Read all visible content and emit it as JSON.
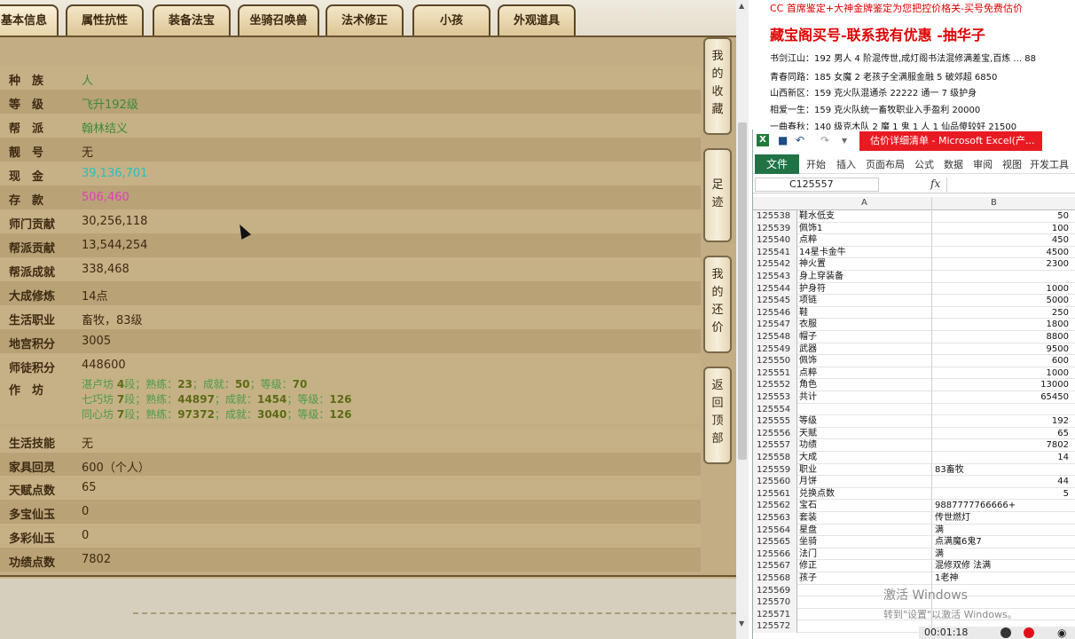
{
  "tabs": [
    "基本信息",
    "属性抗性",
    "装备法宝",
    "坐骑召唤兽",
    "法术修正",
    "小孩",
    "外观道具"
  ],
  "rows": [
    {
      "label": "种　族",
      "value": "人",
      "color": "green"
    },
    {
      "label": "等　级",
      "value": "飞升192级",
      "color": "green"
    },
    {
      "label": "帮　派",
      "value": "翰林结义",
      "color": "green"
    },
    {
      "label": "靓　号",
      "value": "无",
      "color": "normal"
    },
    {
      "label": "现　金",
      "value": "39,136,701",
      "color": "cyan"
    },
    {
      "label": "存　款",
      "value": "506,460",
      "color": "pink"
    },
    {
      "label": "师门贡献",
      "value": "30,256,118",
      "color": "normal"
    },
    {
      "label": "帮派贡献",
      "value": "13,544,254",
      "color": "normal"
    },
    {
      "label": "帮派成就",
      "value": "338,468",
      "color": "normal"
    },
    {
      "label": "大成修炼",
      "value": "14点",
      "color": "normal"
    },
    {
      "label": "生活职业",
      "value": "畜牧，83级",
      "color": "normal"
    },
    {
      "label": "地宫积分",
      "value": "3005",
      "color": "normal"
    },
    {
      "label": "师徒积分",
      "value": "448600",
      "color": "normal"
    }
  ],
  "workshop": {
    "label": "作　坊",
    "lines": [
      {
        "name": "湛卢坊",
        "seg": "4",
        "seg_unit": "段；熟练：",
        "skill": "23",
        "ach_label": "；成就：",
        "ach": "50",
        "lvl_label": "；等级：",
        "lvl": "70"
      },
      {
        "name": "七巧坊",
        "seg": "7",
        "seg_unit": "段；熟练：",
        "skill": "44897",
        "ach_label": "；成就：",
        "ach": "1454",
        "lvl_label": "；等级：",
        "lvl": "126"
      },
      {
        "name": "同心坊",
        "seg": "7",
        "seg_unit": "段；熟练：",
        "skill": "97372",
        "ach_label": "；成就：",
        "ach": "3040",
        "lvl_label": "；等级：",
        "lvl": "126"
      }
    ]
  },
  "rows2": [
    {
      "label": "生活技能",
      "value": "无",
      "color": "normal"
    },
    {
      "label": "家具回灵",
      "value": "600（个人）",
      "color": "normal"
    },
    {
      "label": "天赋点数",
      "value": "65",
      "color": "normal"
    },
    {
      "label": "多宝仙玉",
      "value": "0",
      "color": "normal"
    },
    {
      "label": "多彩仙玉",
      "value": "0",
      "color": "normal"
    },
    {
      "label": "功绩点数",
      "value": "7802",
      "color": "normal"
    }
  ],
  "side_buttons": [
    {
      "chars": [
        "我",
        "的",
        "收",
        "藏"
      ]
    },
    {
      "chars": [
        "足",
        "迹"
      ]
    },
    {
      "chars": [
        "我",
        "的",
        "还",
        "价"
      ]
    },
    {
      "chars": [
        "返",
        "回",
        "顶",
        "部"
      ]
    }
  ],
  "doc": {
    "top": "CC 首席鉴定+大神金牌鉴定为您把控价格关-买号免费估价",
    "head": "藏宝阁买号-联系我有优惠 -抽华子",
    "lines": [
      "书剑江山：192 男人 4 阶混传世,成灯阁书法混修满差宝,百炼 ... 88",
      "青春同路：185 女魔 2 老孩子全满服金融 5 破郊超 6850",
      "山西新区：159 克火队混通杀 22222 通一 7 级护身",
      "相爱一生：159 克火队统一畜牧职业入手盈利 20000",
      "一曲春秋：140 级克木队 2 魔 1 鬼 1 人 1 仙品傻较好 21500"
    ]
  },
  "excel": {
    "title": "估价详细清单 - Microsoft Excel(产...",
    "ribbon": [
      "文件",
      "开始",
      "插入",
      "页面布局",
      "公式",
      "数据",
      "审阅",
      "视图",
      "开发工具"
    ],
    "namebox": "C125557",
    "fx": "fx",
    "col_a": "A",
    "col_b": "B",
    "rows": [
      {
        "n": "125538",
        "a": "鞋水低支",
        "b": "50",
        "t": "num"
      },
      {
        "n": "125539",
        "a": "佩饰1",
        "b": "100",
        "t": "num"
      },
      {
        "n": "125540",
        "a": "点粹",
        "b": "450",
        "t": "num"
      },
      {
        "n": "125541",
        "a": "14星卡金牛",
        "b": "4500",
        "t": "num"
      },
      {
        "n": "125542",
        "a": "神火置",
        "b": "2300",
        "t": "num"
      },
      {
        "n": "125543",
        "a": "身上穿装备",
        "b": "",
        "t": "num"
      },
      {
        "n": "125544",
        "a": "护身符",
        "b": "1000",
        "t": "num"
      },
      {
        "n": "125545",
        "a": "项链",
        "b": "5000",
        "t": "num"
      },
      {
        "n": "125546",
        "a": "鞋",
        "b": "250",
        "t": "num"
      },
      {
        "n": "125547",
        "a": "衣服",
        "b": "1800",
        "t": "num"
      },
      {
        "n": "125548",
        "a": "帽子",
        "b": "8800",
        "t": "num"
      },
      {
        "n": "125549",
        "a": "武器",
        "b": "9500",
        "t": "num"
      },
      {
        "n": "125550",
        "a": "佩饰",
        "b": "600",
        "t": "num"
      },
      {
        "n": "125551",
        "a": "点粹",
        "b": "1000",
        "t": "num"
      },
      {
        "n": "125552",
        "a": "角色",
        "b": "13000",
        "t": "num"
      },
      {
        "n": "125553",
        "a": "共计",
        "b": "65450",
        "t": "num"
      },
      {
        "n": "125554",
        "a": "",
        "b": "",
        "t": "num"
      },
      {
        "n": "125555",
        "a": "等级",
        "b": "192",
        "t": "num"
      },
      {
        "n": "125556",
        "a": "天赋",
        "b": "65",
        "t": "num"
      },
      {
        "n": "125557",
        "a": "功绩",
        "b": "7802",
        "t": "num"
      },
      {
        "n": "125558",
        "a": "大成",
        "b": "14",
        "t": "num"
      },
      {
        "n": "125559",
        "a": "职业",
        "b": "83畜牧",
        "t": "txt"
      },
      {
        "n": "125560",
        "a": "月饼",
        "b": "44",
        "t": "num"
      },
      {
        "n": "125561",
        "a": "兑换点数",
        "b": "5",
        "t": "num"
      },
      {
        "n": "125562",
        "a": "宝石",
        "b": "9887777766666+",
        "t": "txt"
      },
      {
        "n": "125563",
        "a": "套装",
        "b": "传世燃灯",
        "t": "txt"
      },
      {
        "n": "125564",
        "a": "星盘",
        "b": "满",
        "t": "txt"
      },
      {
        "n": "125565",
        "a": "坐骑",
        "b": "点满魔6鬼7",
        "t": "txt"
      },
      {
        "n": "125566",
        "a": "法门",
        "b": "满",
        "t": "txt"
      },
      {
        "n": "125567",
        "a": "修正",
        "b": "混修双修 法满",
        "t": "txt"
      },
      {
        "n": "125568",
        "a": "孩子",
        "b": "1老神",
        "t": "txt"
      },
      {
        "n": "125569",
        "a": "",
        "b": "",
        "t": "num"
      },
      {
        "n": "125570",
        "a": "",
        "b": "",
        "t": "num"
      },
      {
        "n": "125571",
        "a": "",
        "b": "",
        "t": "num"
      },
      {
        "n": "125572",
        "a": "",
        "b": "",
        "t": "num"
      }
    ]
  },
  "watermark": "激活 Windows",
  "watermark_sub": "转到\"设置\"以激活 Windows。",
  "rec_time": "00:01:18"
}
